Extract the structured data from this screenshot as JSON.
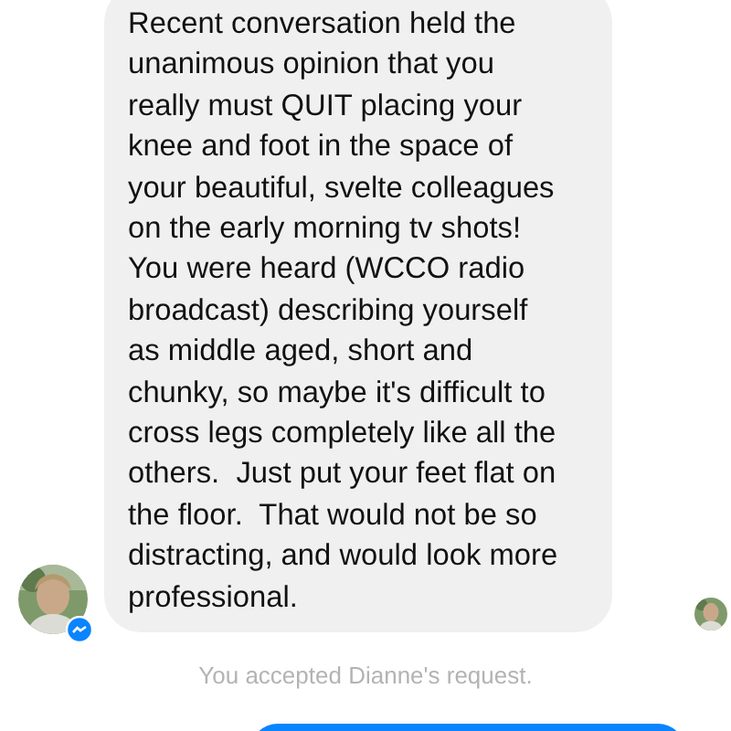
{
  "conversation": {
    "incoming_message": {
      "text": "Recent conversation held the\nunanimous opinion that you\nreally must QUIT placing your\nknee and foot in the space of\nyour beautiful, svelte colleagues\non the early morning tv shots!\nYou were heard (WCCO radio\nbroadcast) describing yourself\nas middle aged, short and\nchunky, so maybe it's difficult to\ncross legs completely like all the\nothers.  Just put your feet flat on\nthe floor.  That would not be so\ndistracting, and would look more\nprofessional."
    },
    "system_notice": "You accepted Dianne's request.",
    "outgoing_message": {
      "kind": "bubble"
    }
  }
}
